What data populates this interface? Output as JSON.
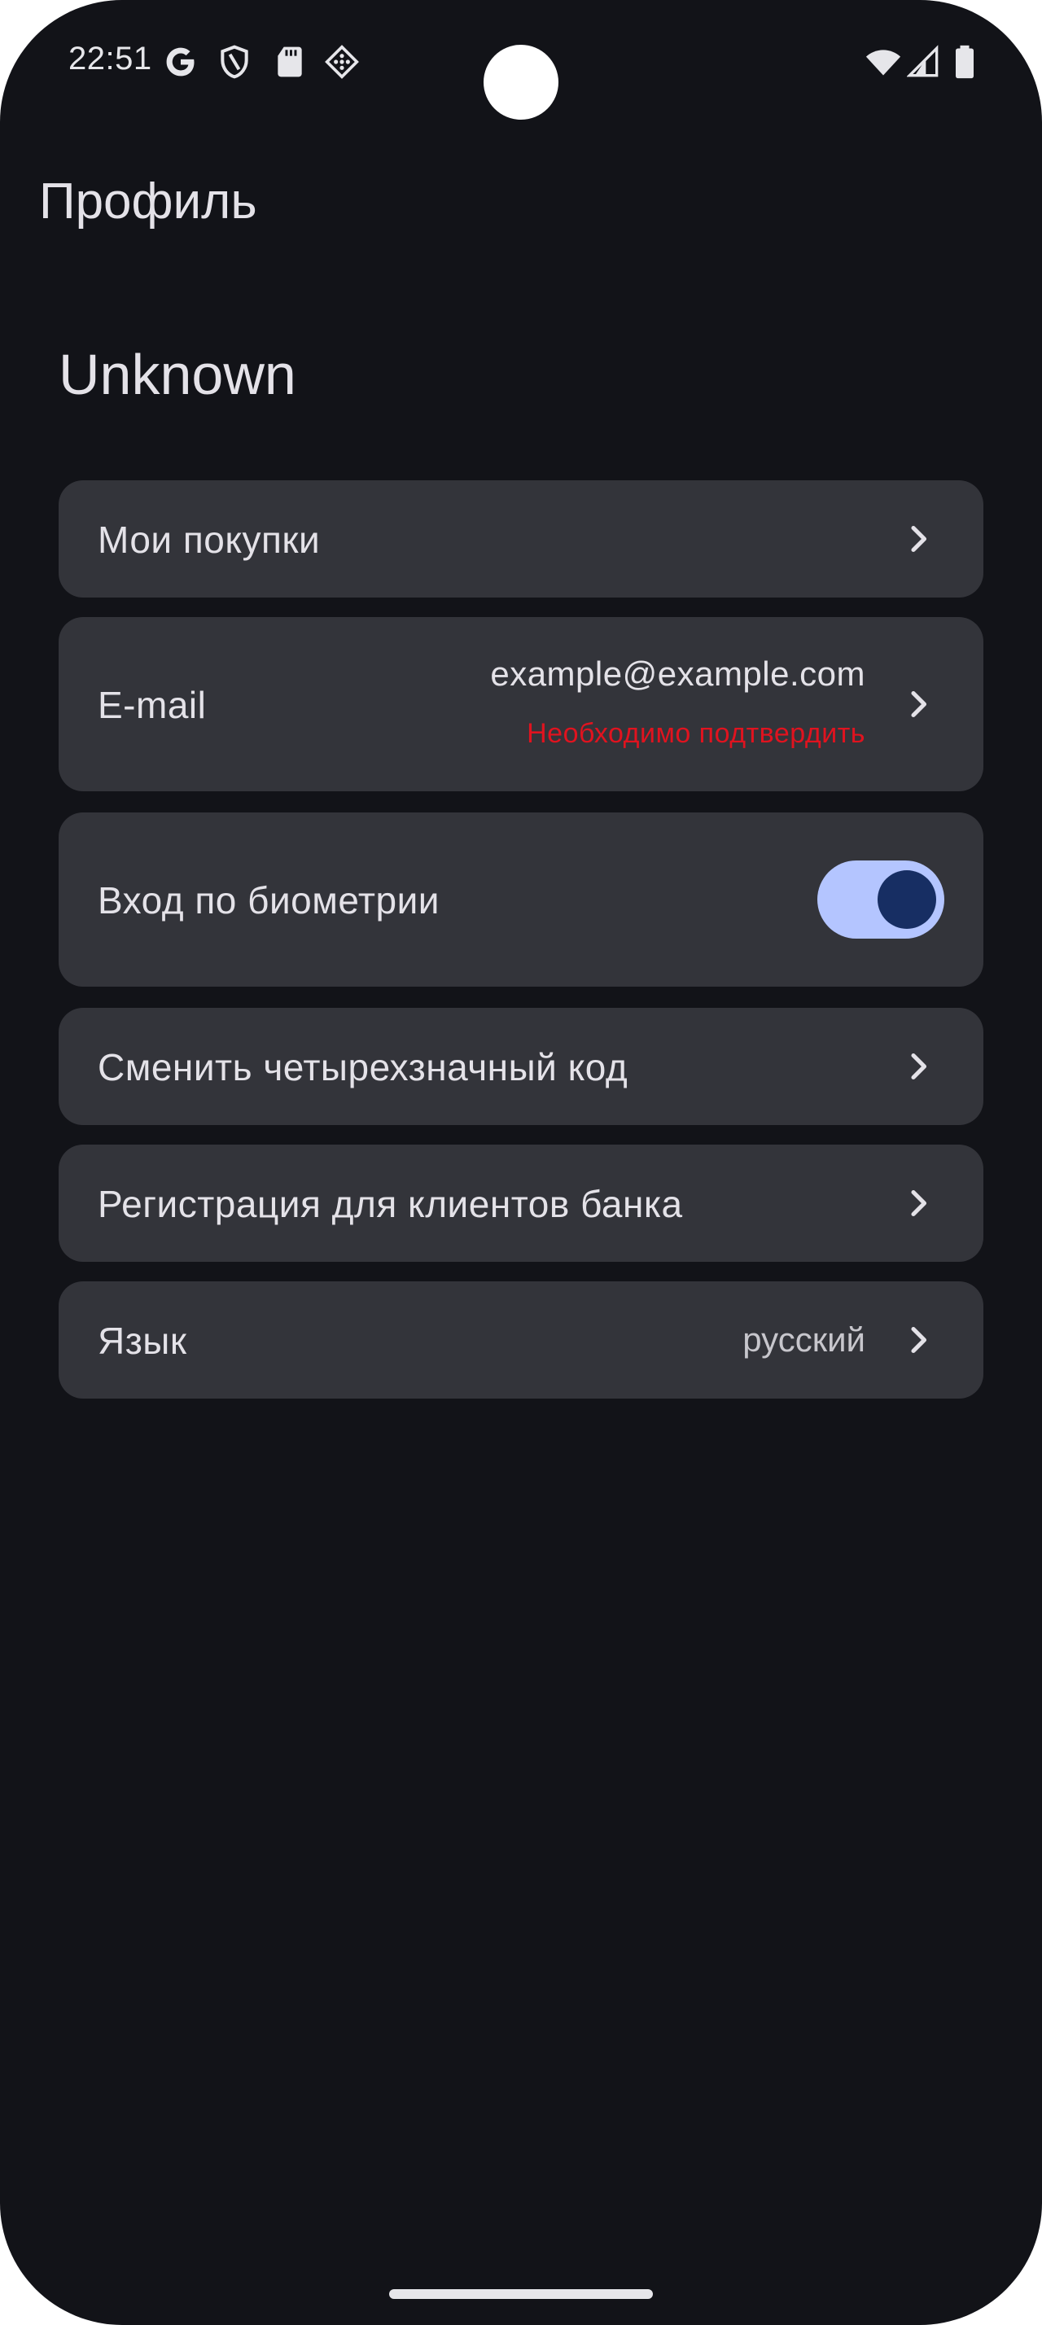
{
  "status_bar": {
    "time": "22:51",
    "icons": [
      "google-icon",
      "shield-icon",
      "sd-card-icon",
      "dice-icon",
      "wifi-icon",
      "signal-icon",
      "battery-icon"
    ]
  },
  "header": {
    "title": "Профиль"
  },
  "profile": {
    "name": "Unknown"
  },
  "menu": {
    "purchases": {
      "label": "Мои покупки"
    },
    "email": {
      "label": "E-mail",
      "value": "example@example.com",
      "status": "Необходимо подтвердить"
    },
    "biometrics": {
      "label": "Вход по биометрии",
      "enabled": true
    },
    "change_code": {
      "label": "Сменить четырехзначный код"
    },
    "bank_registration": {
      "label": "Регистрация для клиентов банка"
    },
    "language": {
      "label": "Язык",
      "value": "русский"
    }
  },
  "colors": {
    "background": "#121318",
    "card": "#33343a",
    "text": "#e4e2e8",
    "warning": "#e0131f",
    "toggle_track": "#b4c5ff",
    "toggle_thumb": "#172e63"
  }
}
